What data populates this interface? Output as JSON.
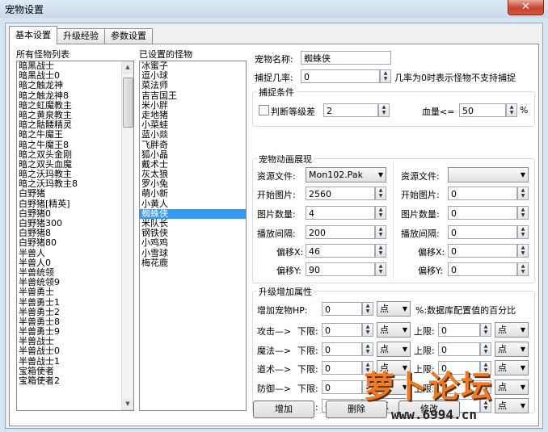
{
  "window": {
    "title": "宠物设置",
    "close_glyph": "✕"
  },
  "tabs": [
    {
      "label": "基本设置",
      "active": true
    },
    {
      "label": "升级经验"
    },
    {
      "label": "参数设置"
    }
  ],
  "all_monsters": {
    "label": "所有怪物列表",
    "items": [
      "暗黑战士",
      "暗黑战士0",
      "暗之触龙神",
      "暗之触龙神8",
      "暗之虹魔教主",
      "暗之黄泉教主",
      "暗之骷髅精灵",
      "暗之牛魔王",
      "暗之牛魔王8",
      "暗之双头金刚",
      "暗之双头血魔",
      "暗之沃玛教主",
      "暗之沃玛教主8",
      "白野猪",
      "白野猪[精英]",
      "白野猪0",
      "白野猪300",
      "白野猪8",
      "白野猪80",
      "半兽人",
      "半兽人0",
      "半兽统领",
      "半兽统领9",
      "半兽勇士",
      "半兽勇士1",
      "半兽勇士2",
      "半兽勇士8",
      "半兽勇士9",
      "半兽战士",
      "半兽战士0",
      "半兽战士1",
      "宝箱使者",
      "宝箱使者2"
    ]
  },
  "set_monsters": {
    "label": "已设置的怪物",
    "items": [
      "冰蜜子",
      "逗小球",
      "菜法师",
      "吉吉国王",
      "米小胖",
      "走地猪",
      "小菜蛙",
      "蓝小燚",
      "飞胖奇",
      "狐小晶",
      "戴术士",
      "灰太狼",
      "罗小兔",
      "萌小新",
      "小黄人",
      "蜘蛛侠",
      "米队长",
      "钢铁侠",
      "小鸡鸡",
      "小雪球",
      "梅花鹿"
    ],
    "selected_index": 15
  },
  "form": {
    "pet_name_label": "宠物名称:",
    "pet_name": "蜘蛛侠",
    "catch_rate_label": "捕捉几率:",
    "catch_rate": "0",
    "catch_rate_note": "几率为0时表示怪物不支持捕捉",
    "catch_cond_group": "捕捉条件",
    "level_check_label": "判断等级差",
    "level_diff": "2",
    "hp_label": "血量<=",
    "hp_value": "50",
    "hp_unit": "%",
    "anim_group": "宠物动画展现",
    "res_file_label": "资源文件:",
    "res_file": "Mon102.Pak",
    "res_file2": "",
    "start_pic_label": "开始图片:",
    "start_pic": "2560",
    "start_pic2": "0",
    "pic_count_label": "图片数量:",
    "pic_count": "4",
    "pic_count2": "0",
    "interval_label": "播放间隔:",
    "interval": "200",
    "interval2": "0",
    "offset_x_label": "偏移X:",
    "offset_x": "46",
    "offset_x2": "0",
    "offset_y_label": "偏移Y:",
    "offset_y": "90",
    "offset_y2": "0",
    "upgrade_group": "升级增加属性",
    "add_hp_label": "增加宠物HP:",
    "add_hp": "0",
    "add_hp_unit": "点",
    "add_hp_note": "%:数据库配置值的百分比",
    "lower_label": "下限:",
    "upper_label": "上限:",
    "attrs": [
      {
        "name": "攻击—>",
        "lower": "0",
        "lower_unit": "点",
        "upper": "0",
        "upper_unit": "点"
      },
      {
        "name": "魔法—>",
        "lower": "0",
        "lower_unit": "点",
        "upper": "0",
        "upper_unit": "点"
      },
      {
        "name": "道术—>",
        "lower": "0",
        "lower_unit": "点",
        "upper": "0",
        "upper_unit": "点"
      },
      {
        "name": "防御—>",
        "lower": "0",
        "lower_unit": "点",
        "upper": "0",
        "upper_unit": "点"
      },
      {
        "name": "魔防—>",
        "lower": "0",
        "lower_unit": "点",
        "upper": "0",
        "upper_unit": "点"
      }
    ]
  },
  "buttons": {
    "add": "增加",
    "delete": "删除",
    "modify": "修改"
  },
  "watermark": {
    "brand": "萝卜论坛",
    "url": "www.6994.cn"
  }
}
